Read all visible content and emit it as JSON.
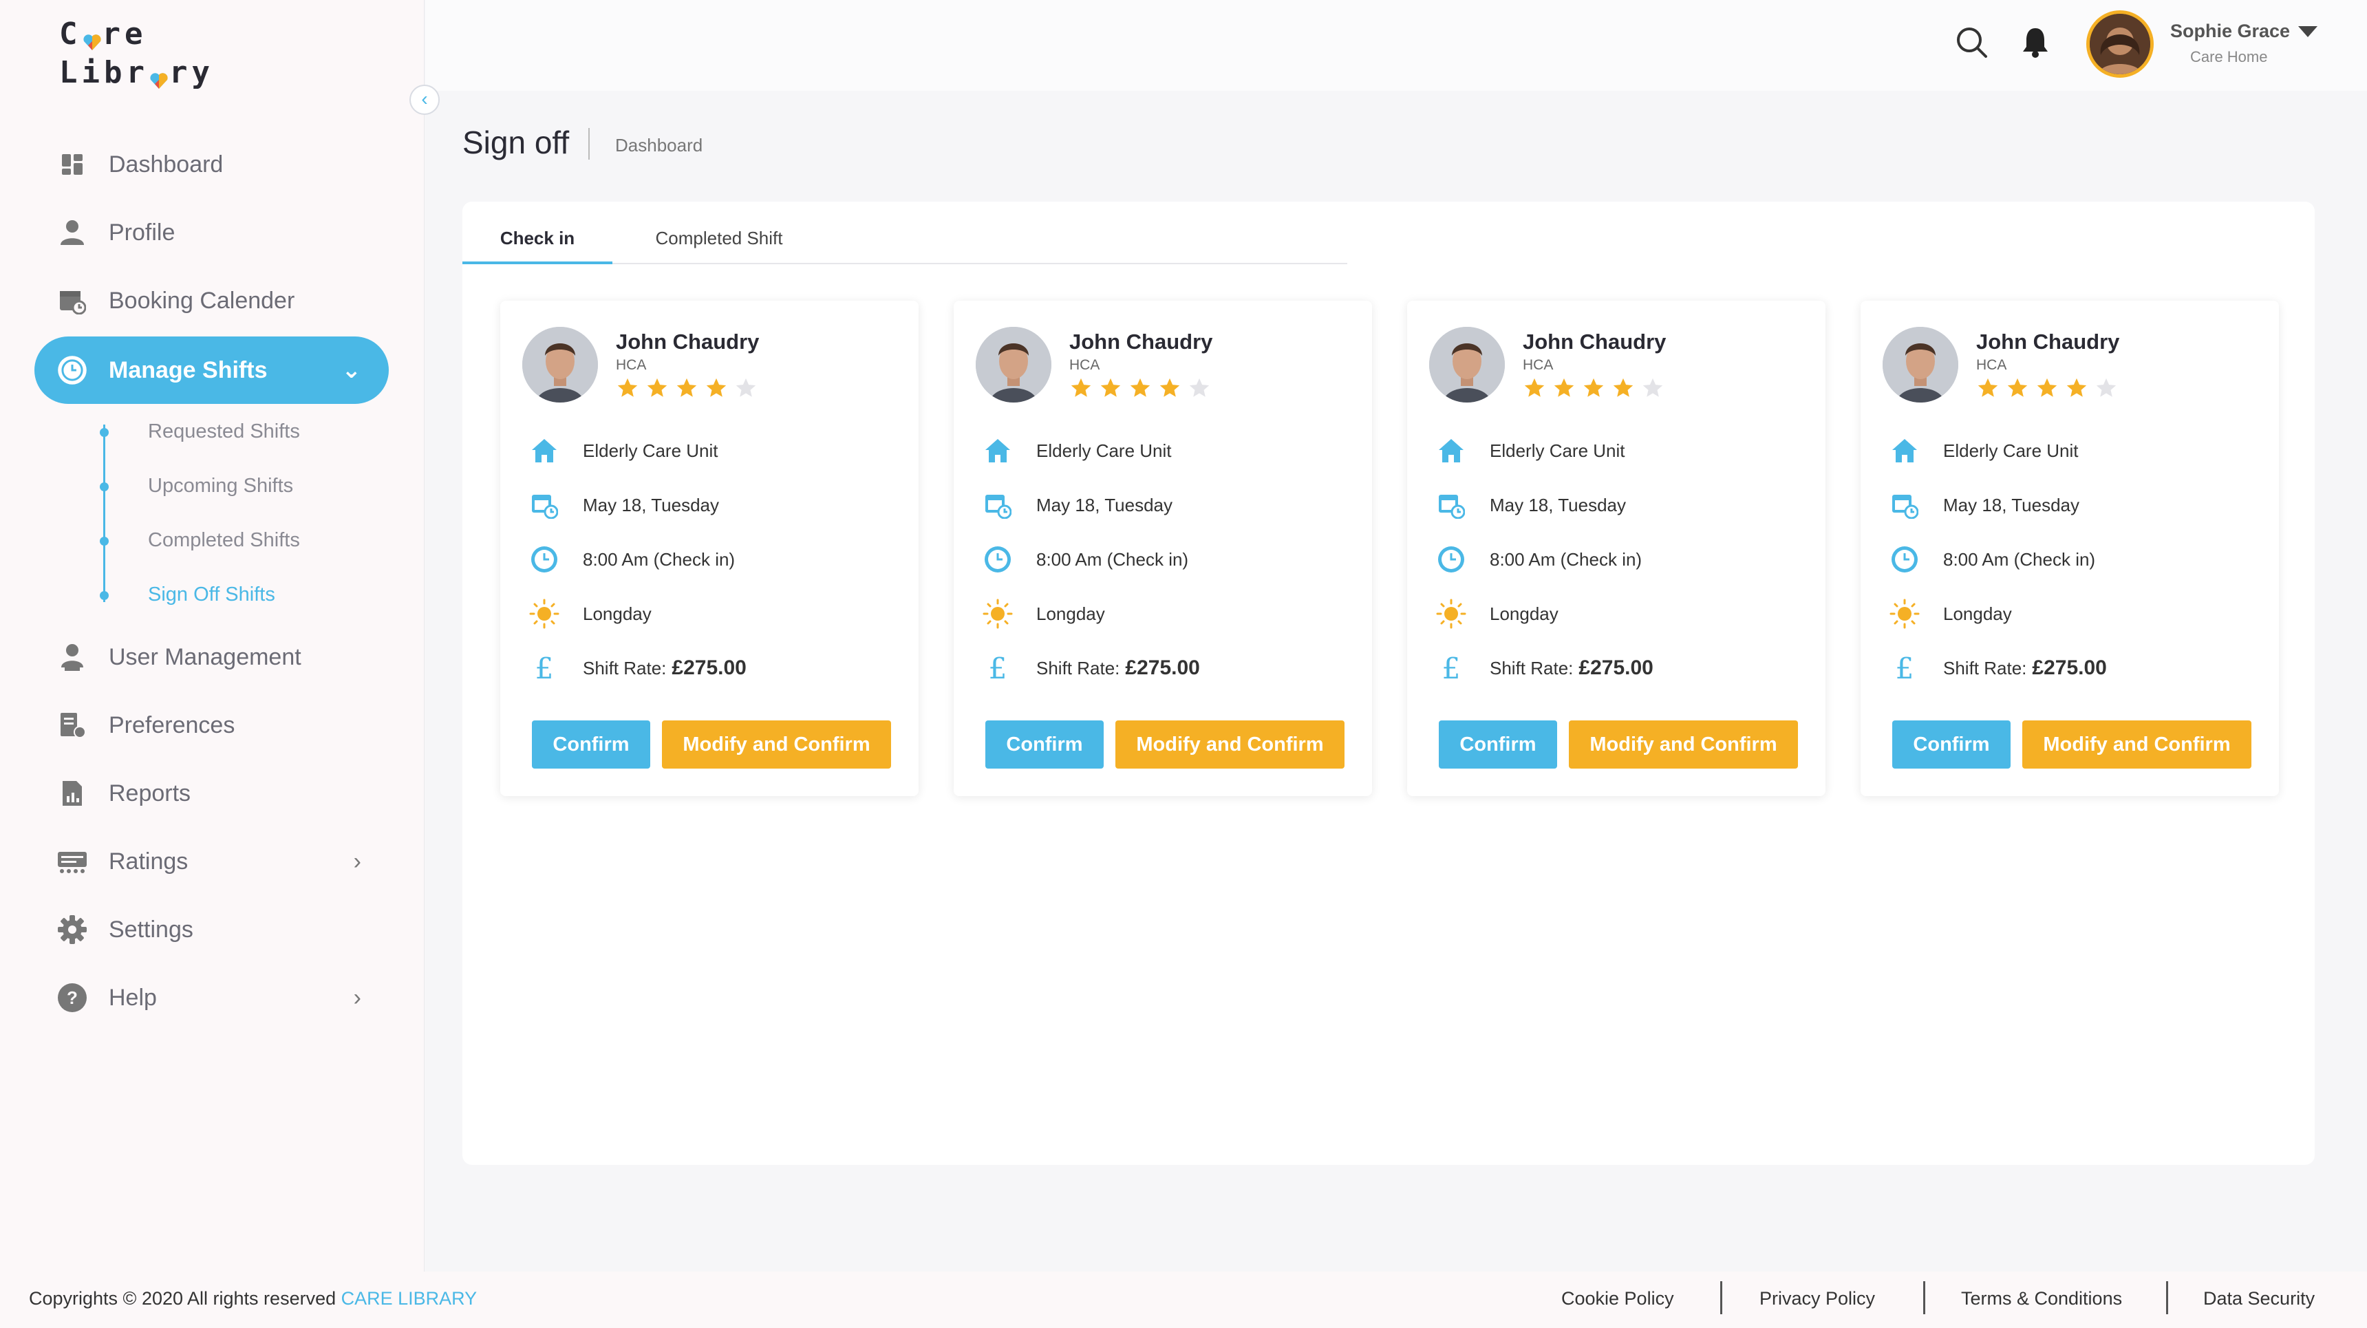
{
  "brand": {
    "logo_line1": "Care",
    "logo_line2": "Library"
  },
  "sidebar": {
    "items": [
      {
        "label": "Dashboard",
        "icon": "dashboard-icon"
      },
      {
        "label": "Profile",
        "icon": "user-icon"
      },
      {
        "label": "Booking Calender",
        "icon": "calendar-icon"
      },
      {
        "label": "Manage Shifts",
        "icon": "clock-icon",
        "active": true,
        "expanded": true
      },
      {
        "label": "User Management",
        "icon": "user-manage-icon"
      },
      {
        "label": "Preferences",
        "icon": "preferences-icon"
      },
      {
        "label": "Reports",
        "icon": "report-icon"
      },
      {
        "label": "Ratings",
        "icon": "ratings-icon",
        "has_submenu": true
      },
      {
        "label": "Settings",
        "icon": "gear-icon"
      },
      {
        "label": "Help",
        "icon": "help-icon",
        "has_submenu": true
      }
    ],
    "subitems": [
      {
        "label": "Requested Shifts"
      },
      {
        "label": "Upcoming Shifts"
      },
      {
        "label": "Completed Shifts"
      },
      {
        "label": "Sign Off Shifts",
        "active": true
      }
    ]
  },
  "header": {
    "user_name": "Sophie Grace",
    "user_role": "Care Home"
  },
  "page": {
    "title": "Sign off",
    "breadcrumb": "Dashboard"
  },
  "tabs": [
    {
      "label": "Check in",
      "active": true
    },
    {
      "label": "Completed Shift",
      "active": false
    }
  ],
  "cards": [
    {
      "name": "John Chaudry",
      "role": "HCA",
      "rating": 4,
      "rating_max": 5,
      "unit": "Elderly Care Unit",
      "date": "May 18, Tuesday",
      "time": "8:00 Am (Check in)",
      "shift_type": "Longday",
      "rate_label": "Shift Rate:",
      "rate_value": "£275.00",
      "confirm": "Confirm",
      "modify": "Modify and Confirm"
    },
    {
      "name": "John Chaudry",
      "role": "HCA",
      "rating": 4,
      "rating_max": 5,
      "unit": "Elderly Care Unit",
      "date": "May 18, Tuesday",
      "time": "8:00 Am (Check in)",
      "shift_type": "Longday",
      "rate_label": "Shift Rate:",
      "rate_value": "£275.00",
      "confirm": "Confirm",
      "modify": "Modify and Confirm"
    },
    {
      "name": "John Chaudry",
      "role": "HCA",
      "rating": 4,
      "rating_max": 5,
      "unit": "Elderly Care Unit",
      "date": "May 18, Tuesday",
      "time": "8:00 Am (Check in)",
      "shift_type": "Longday",
      "rate_label": "Shift Rate:",
      "rate_value": "£275.00",
      "confirm": "Confirm",
      "modify": "Modify and Confirm"
    },
    {
      "name": "John Chaudry",
      "role": "HCA",
      "rating": 4,
      "rating_max": 5,
      "unit": "Elderly Care Unit",
      "date": "May 18, Tuesday",
      "time": "8:00 Am (Check in)",
      "shift_type": "Longday",
      "rate_label": "Shift Rate:",
      "rate_value": "£275.00",
      "confirm": "Confirm",
      "modify": "Modify and Confirm"
    }
  ],
  "footer": {
    "copyright": "Copyrights © 2020  All rights reserved",
    "brand": "CARE LIBRARY",
    "links": [
      "Cookie Policy",
      "Privacy Policy",
      "Terms & Conditions",
      "Data Security"
    ]
  },
  "colors": {
    "accent": "#4ab8e6",
    "warning": "#f5b025",
    "star": "#f5b025",
    "star_empty": "#e3e3e7"
  }
}
